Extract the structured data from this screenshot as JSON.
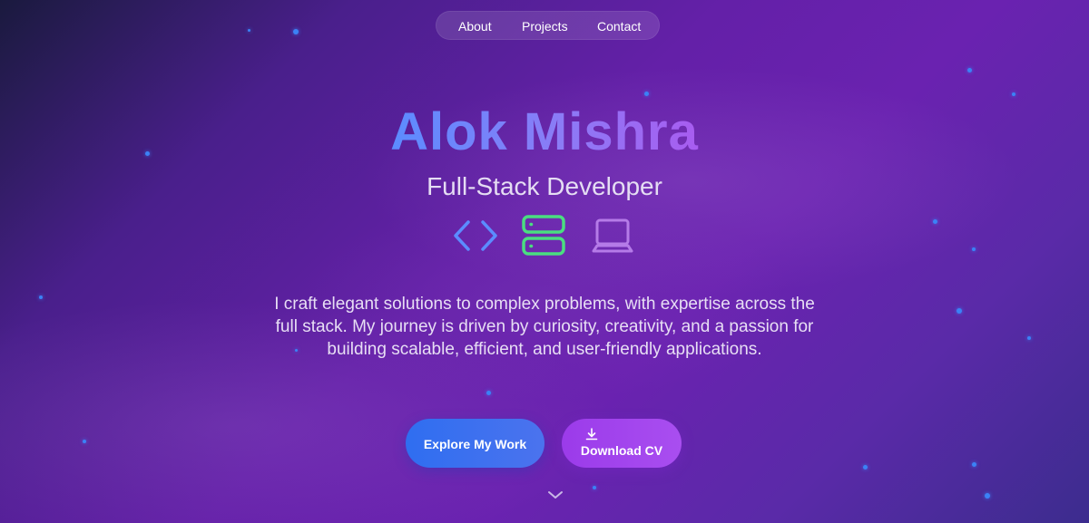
{
  "nav": {
    "items": [
      {
        "label": "About"
      },
      {
        "label": "Projects"
      },
      {
        "label": "Contact"
      }
    ]
  },
  "hero": {
    "name": "Alok Mishra",
    "role": "Full-Stack Developer",
    "icons": [
      "code-brackets-icon",
      "server-icon",
      "laptop-icon"
    ],
    "bio": "I craft elegant solutions to complex problems, with expertise across the full stack. My journey is driven by curiosity, creativity, and a passion for building scalable, efficient, and user-friendly applications."
  },
  "buttons": {
    "explore_label": "Explore My Work",
    "download_label": "Download CV"
  },
  "colors": {
    "accent_blue": "#3b82f6",
    "accent_green": "#4ade80",
    "accent_purple": "#a855f7"
  }
}
